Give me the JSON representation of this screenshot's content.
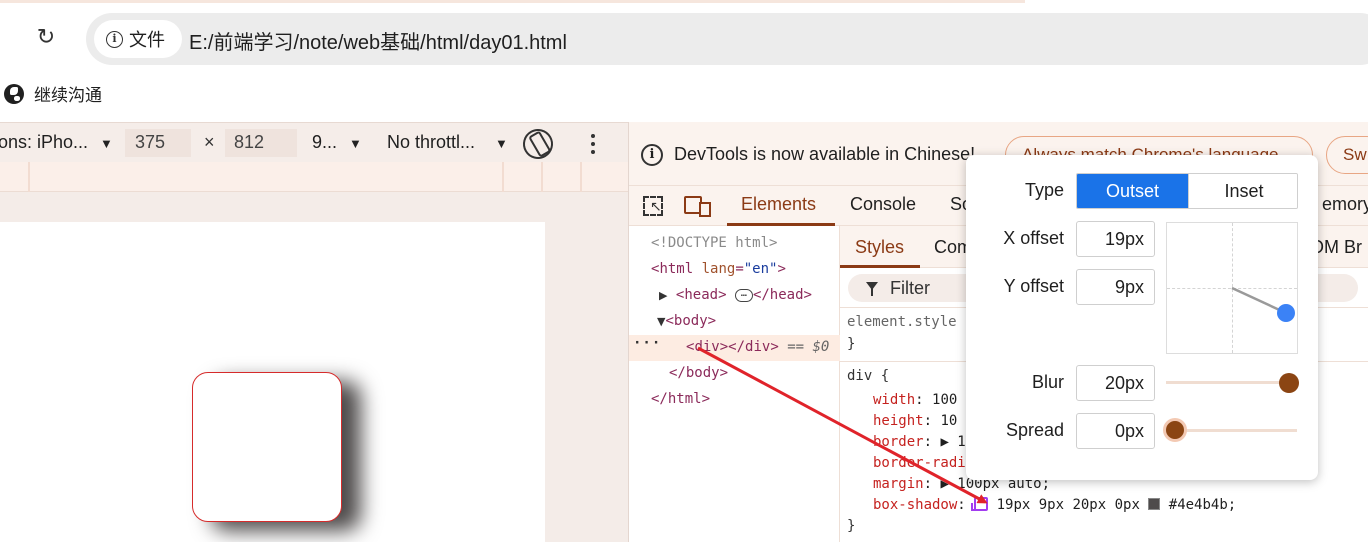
{
  "browser": {
    "reload_glyph": "↻",
    "site_chip": {
      "icon": "info-icon",
      "label": "文件"
    },
    "url": "E:/前端学习/note/web基础/html/day01.html"
  },
  "bookmarks": {
    "items": [
      {
        "icon": "globe-icon",
        "label": "继续沟通"
      }
    ]
  },
  "device_toolbar": {
    "device": "ons: iPho...",
    "width": "375",
    "times": "×",
    "height": "812",
    "zoom": "9...",
    "throttle": "No throttl...",
    "caret": "▼"
  },
  "devtools": {
    "infobar": {
      "text": "DevTools is now available in Chinese!",
      "btn_match": "Always match Chrome's language",
      "btn_switch": "Sw"
    },
    "tabs": [
      "Elements",
      "Console",
      "So",
      "emory"
    ],
    "active_tab": "Elements",
    "dom": {
      "doctype": "<!DOCTYPE html>",
      "html_open": "html",
      "lang_attr": "lang",
      "lang_val": "\"en\"",
      "head": "head",
      "body": "body",
      "div": "div",
      "selected_suffix": "== $0",
      "body_close": "</body>",
      "html_close": "</html>",
      "ellipsis": "···"
    },
    "styles": {
      "tabs": [
        "Styles",
        "Com",
        "OM Br"
      ],
      "filter_label": "Filter",
      "element_style": "element.style {",
      "close_brace": "}",
      "rule_selector": "div {",
      "props": [
        {
          "name": "width",
          "value": "100"
        },
        {
          "name": "height",
          "value": "10"
        },
        {
          "name": "border",
          "value": "▶ 1"
        },
        {
          "name": "border-radi",
          "value": ""
        },
        {
          "name": "margin",
          "value": "▶ 100px auto;"
        }
      ],
      "box_shadow": {
        "name": "box-shadow",
        "value": "19px 9px 20px 0px",
        "color": "#4e4b4b",
        "color_text": "#4e4b4b;"
      }
    }
  },
  "shadow_editor": {
    "type_label": "Type",
    "type_options": [
      "Outset",
      "Inset"
    ],
    "type_selected": "Outset",
    "x_label": "X offset",
    "x_value": "19px",
    "y_label": "Y offset",
    "y_value": "9px",
    "blur_label": "Blur",
    "blur_value": "20px",
    "spread_label": "Spread",
    "spread_value": "0px"
  },
  "colors": {
    "accent": "#8b3a15",
    "selected_blue": "#1a73e8",
    "shadow_color": "#4e4b4b",
    "box_border": "#d62b2b",
    "arrow": "#e0232a"
  }
}
